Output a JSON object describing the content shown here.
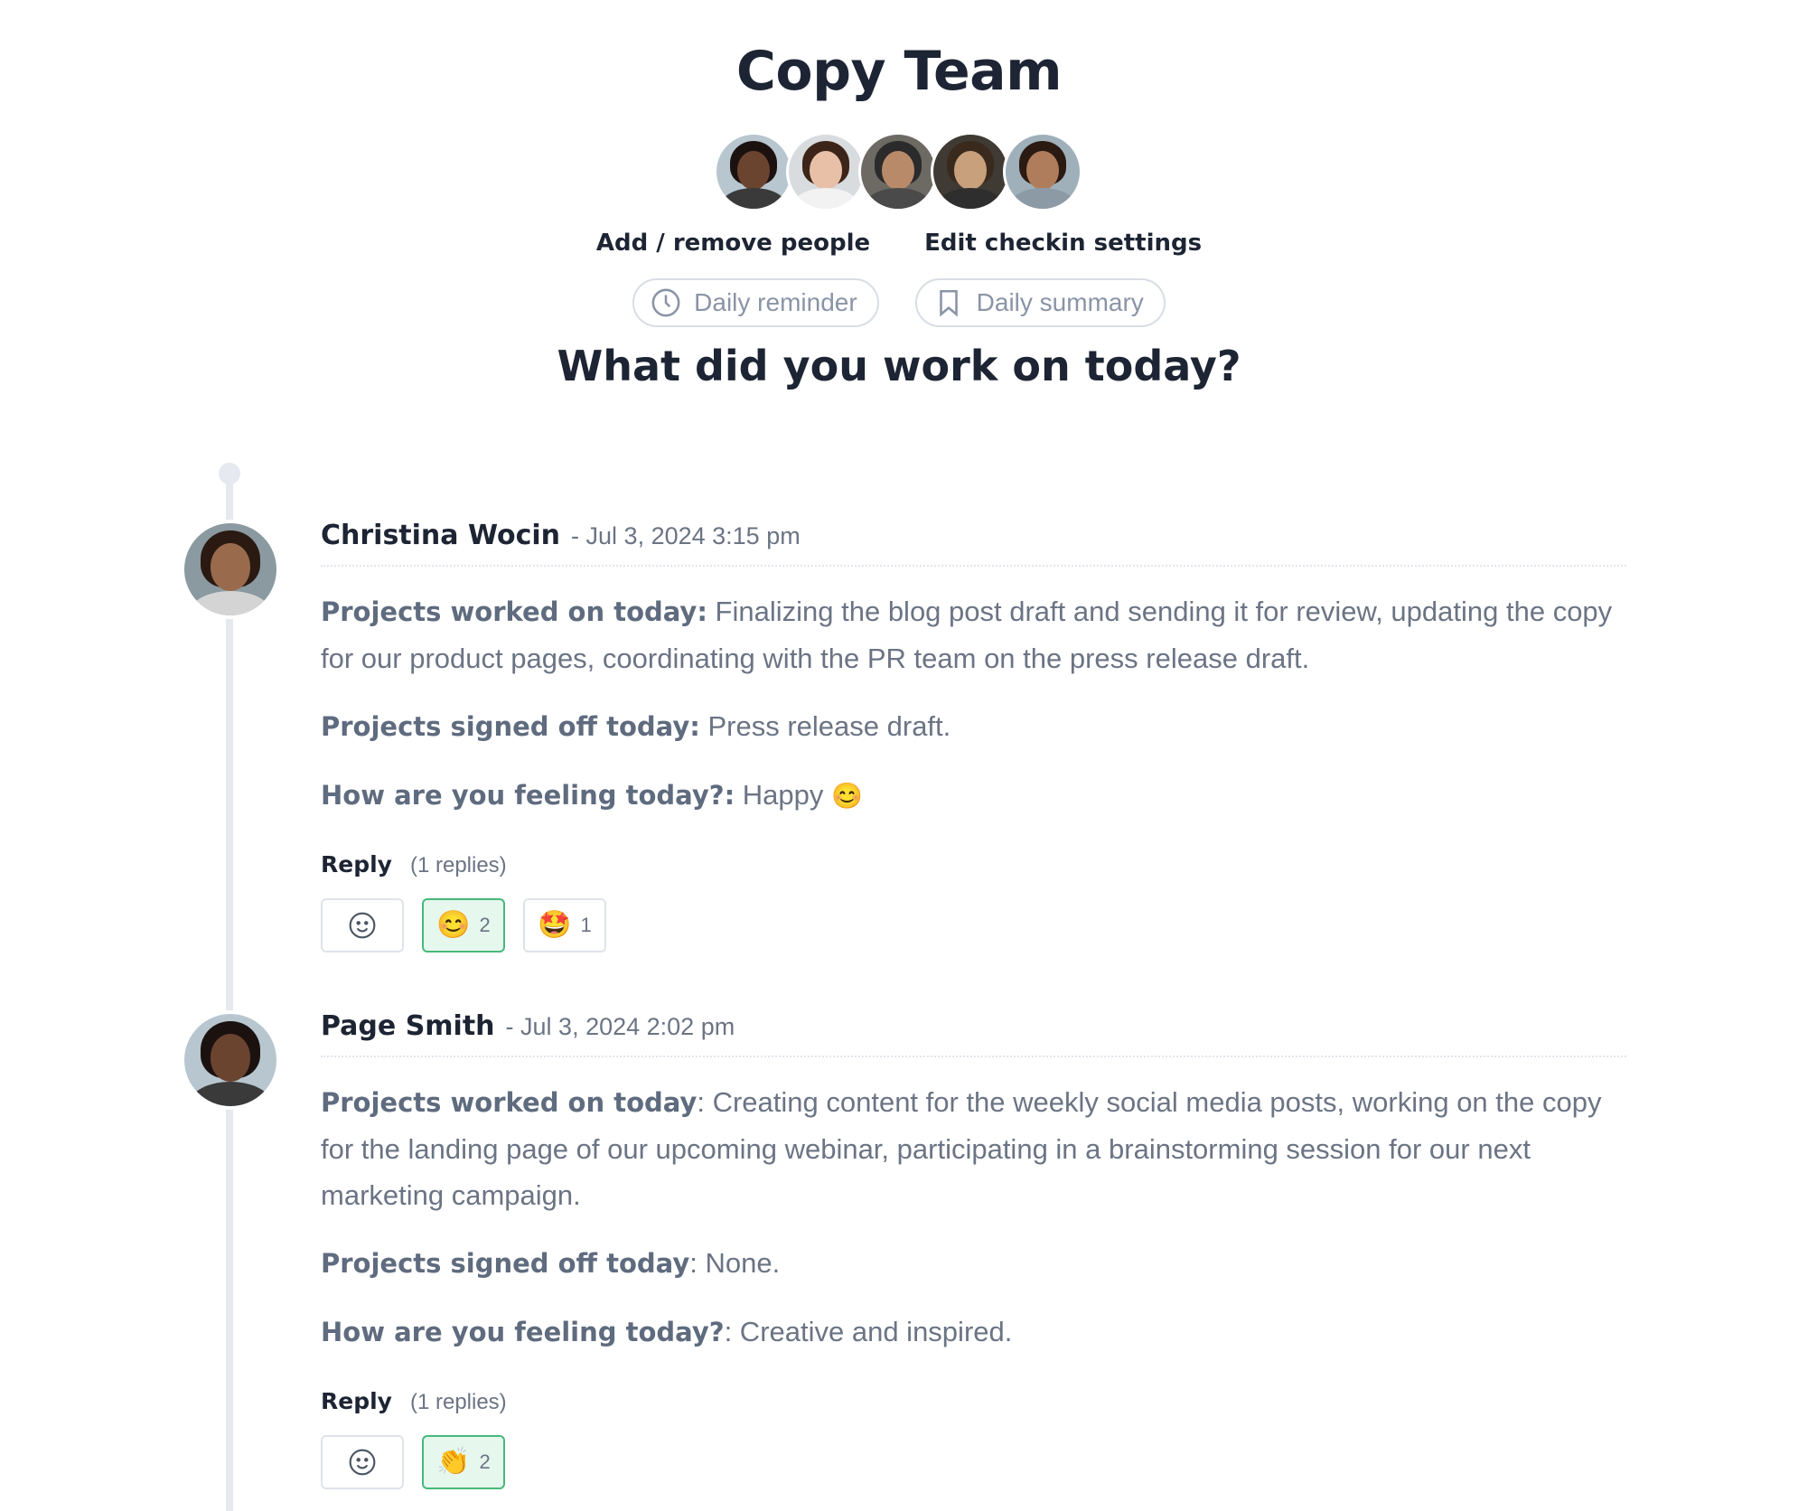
{
  "header": {
    "title": "Copy Team",
    "members": [
      {
        "name": "member-1",
        "skin": "#6b4430",
        "hair": "#1b1210",
        "shirt": "#3a3a3a",
        "bg": "#b8c6cf"
      },
      {
        "name": "member-2",
        "skin": "#e8c0a8",
        "hair": "#3d2418",
        "shirt": "#f2f2f2",
        "bg": "#d9dcdf"
      },
      {
        "name": "member-3",
        "skin": "#b98a6a",
        "hair": "#2b2b2b",
        "shirt": "#4a4a4a",
        "bg": "#6d6a64"
      },
      {
        "name": "member-4",
        "skin": "#c9a07c",
        "hair": "#3a2a1e",
        "shirt": "#2e2e2e",
        "bg": "#3f3a33"
      },
      {
        "name": "member-5",
        "skin": "#b07d5c",
        "hair": "#2a1a12",
        "shirt": "#8c9aa6",
        "bg": "#9fb0ba"
      }
    ],
    "add_remove_label": "Add / remove people",
    "edit_settings_label": "Edit checkin settings",
    "daily_reminder_label": "Daily reminder",
    "daily_summary_label": "Daily summary",
    "question": "What did you work on today?"
  },
  "entries": [
    {
      "author": "Christina Wocin",
      "date": "- Jul 3, 2024 3:15 pm",
      "avatar": {
        "skin": "#9a6a4c",
        "hair": "#2a1a12",
        "shirt": "#d4d4d4",
        "bg": "#8a9aa0"
      },
      "worked_label": "Projects worked on today:",
      "worked_text": " Finalizing the blog post draft and sending it for review, updating the copy for our product pages, coordinating with the PR team on the press release draft.",
      "signed_label": "Projects signed off today:",
      "signed_text": " Press release draft.",
      "feeling_label": "How are you feeling today?:",
      "feeling_text": " Happy ",
      "feeling_emoji": "😊",
      "reply_label": "Reply",
      "replies_count": "(1 replies)",
      "reactions": [
        {
          "emoji": "smiley-add-icon",
          "count": "",
          "active": false
        },
        {
          "emoji": "😊",
          "count": "2",
          "active": true
        },
        {
          "emoji": "🤩",
          "count": "1",
          "active": false
        }
      ]
    },
    {
      "author": "Page Smith",
      "date": "- Jul 3, 2024 2:02 pm",
      "avatar": {
        "skin": "#6b4430",
        "hair": "#1b1210",
        "shirt": "#3a3a3a",
        "bg": "#b8c6cf"
      },
      "worked_label": "Projects worked on today",
      "worked_text": ": Creating content for the weekly social media posts, working on the copy for the landing page of our upcoming webinar, participating in a brainstorming session for our next marketing campaign.",
      "signed_label": "Projects signed off today",
      "signed_text": ": None.",
      "feeling_label": "How are you feeling today?",
      "feeling_text": ": Creative and inspired.",
      "feeling_emoji": "",
      "reply_label": "Reply",
      "replies_count": "(1 replies)",
      "reactions": [
        {
          "emoji": "smiley-add-icon",
          "count": "",
          "active": false
        },
        {
          "emoji": "👏",
          "count": "2",
          "active": true
        }
      ]
    }
  ],
  "colors": {
    "heading": "#1d2433",
    "muted": "#6b7484",
    "reaction_active_bg": "#e6f7ee",
    "reaction_active_border": "#47b97a",
    "timeline": "#e6e9ef"
  }
}
